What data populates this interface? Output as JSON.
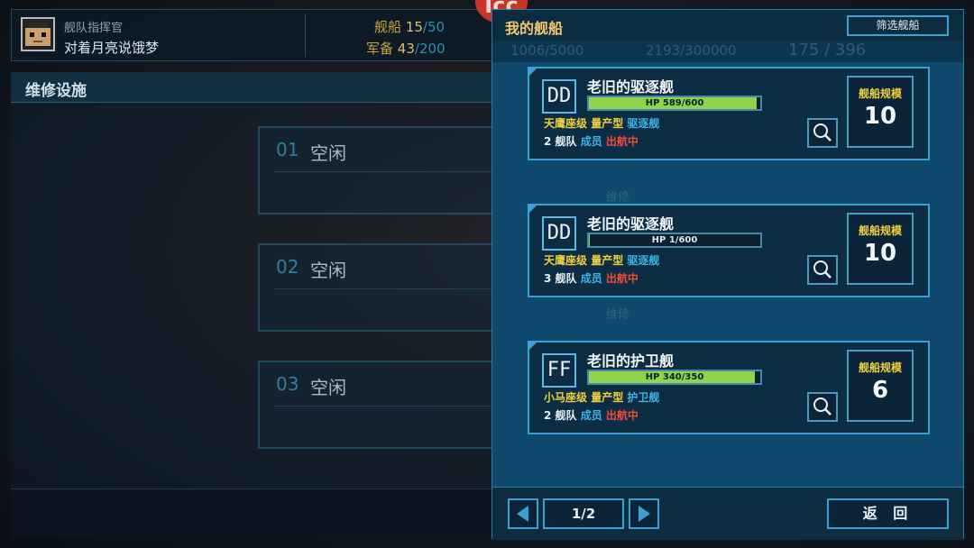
{
  "commander": {
    "title": "舰队指挥官",
    "name": "对着月亮说饿梦"
  },
  "resources": [
    {
      "label": "舰船",
      "value": "15",
      "max": "/50"
    },
    {
      "label": "军备",
      "value": "43",
      "max": "/200"
    }
  ],
  "dimmed_stats": [
    "1006/5000",
    "2193/300000",
    "175 / 396"
  ],
  "logo_text": "Icc",
  "repair": {
    "title": "维修设施",
    "slots": [
      {
        "num": "01",
        "status": "空闲"
      },
      {
        "num": "02",
        "status": "空闲"
      },
      {
        "num": "03",
        "status": "空闲"
      }
    ],
    "repair_label": "维修"
  },
  "ships_panel": {
    "title": "我的舰船",
    "filter_label": "筛选舰船",
    "scale_label": "舰船规模",
    "ships": [
      {
        "type": "DD",
        "name": "老旧的驱逐舰",
        "hp": "HP  589/600",
        "hp_ratio": 0.98,
        "class_name": "天鹰座级",
        "production": "量产型",
        "ship_class": "驱逐舰",
        "fleet": "2 舰队",
        "role": "成员",
        "status": "出航中",
        "scale": "10"
      },
      {
        "type": "DD",
        "name": "老旧的驱逐舰",
        "hp": "HP  1/600",
        "hp_ratio": 0.0017,
        "class_name": "天鹰座级",
        "production": "量产型",
        "ship_class": "驱逐舰",
        "fleet": "3 舰队",
        "role": "成员",
        "status": "出航中",
        "scale": "10"
      },
      {
        "type": "FF",
        "name": "老旧的护卫舰",
        "hp": "HP  340/350",
        "hp_ratio": 0.97,
        "class_name": "小马座级",
        "production": "量产型",
        "ship_class": "护卫舰",
        "fleet": "2 舰队",
        "role": "成员",
        "status": "出航中",
        "scale": "6"
      }
    ],
    "page": "1/2",
    "back_label": "返 回"
  },
  "colors": {
    "panel": "#0f4a6e",
    "accent": "#3da0d2",
    "hp_fill": "#8fd44a",
    "yellow": "#f0d03a",
    "red": "#f04a3a"
  },
  "icons": [
    "avatar-pixel",
    "magnifier-icon",
    "arrow-left-icon",
    "arrow-right-icon"
  ]
}
